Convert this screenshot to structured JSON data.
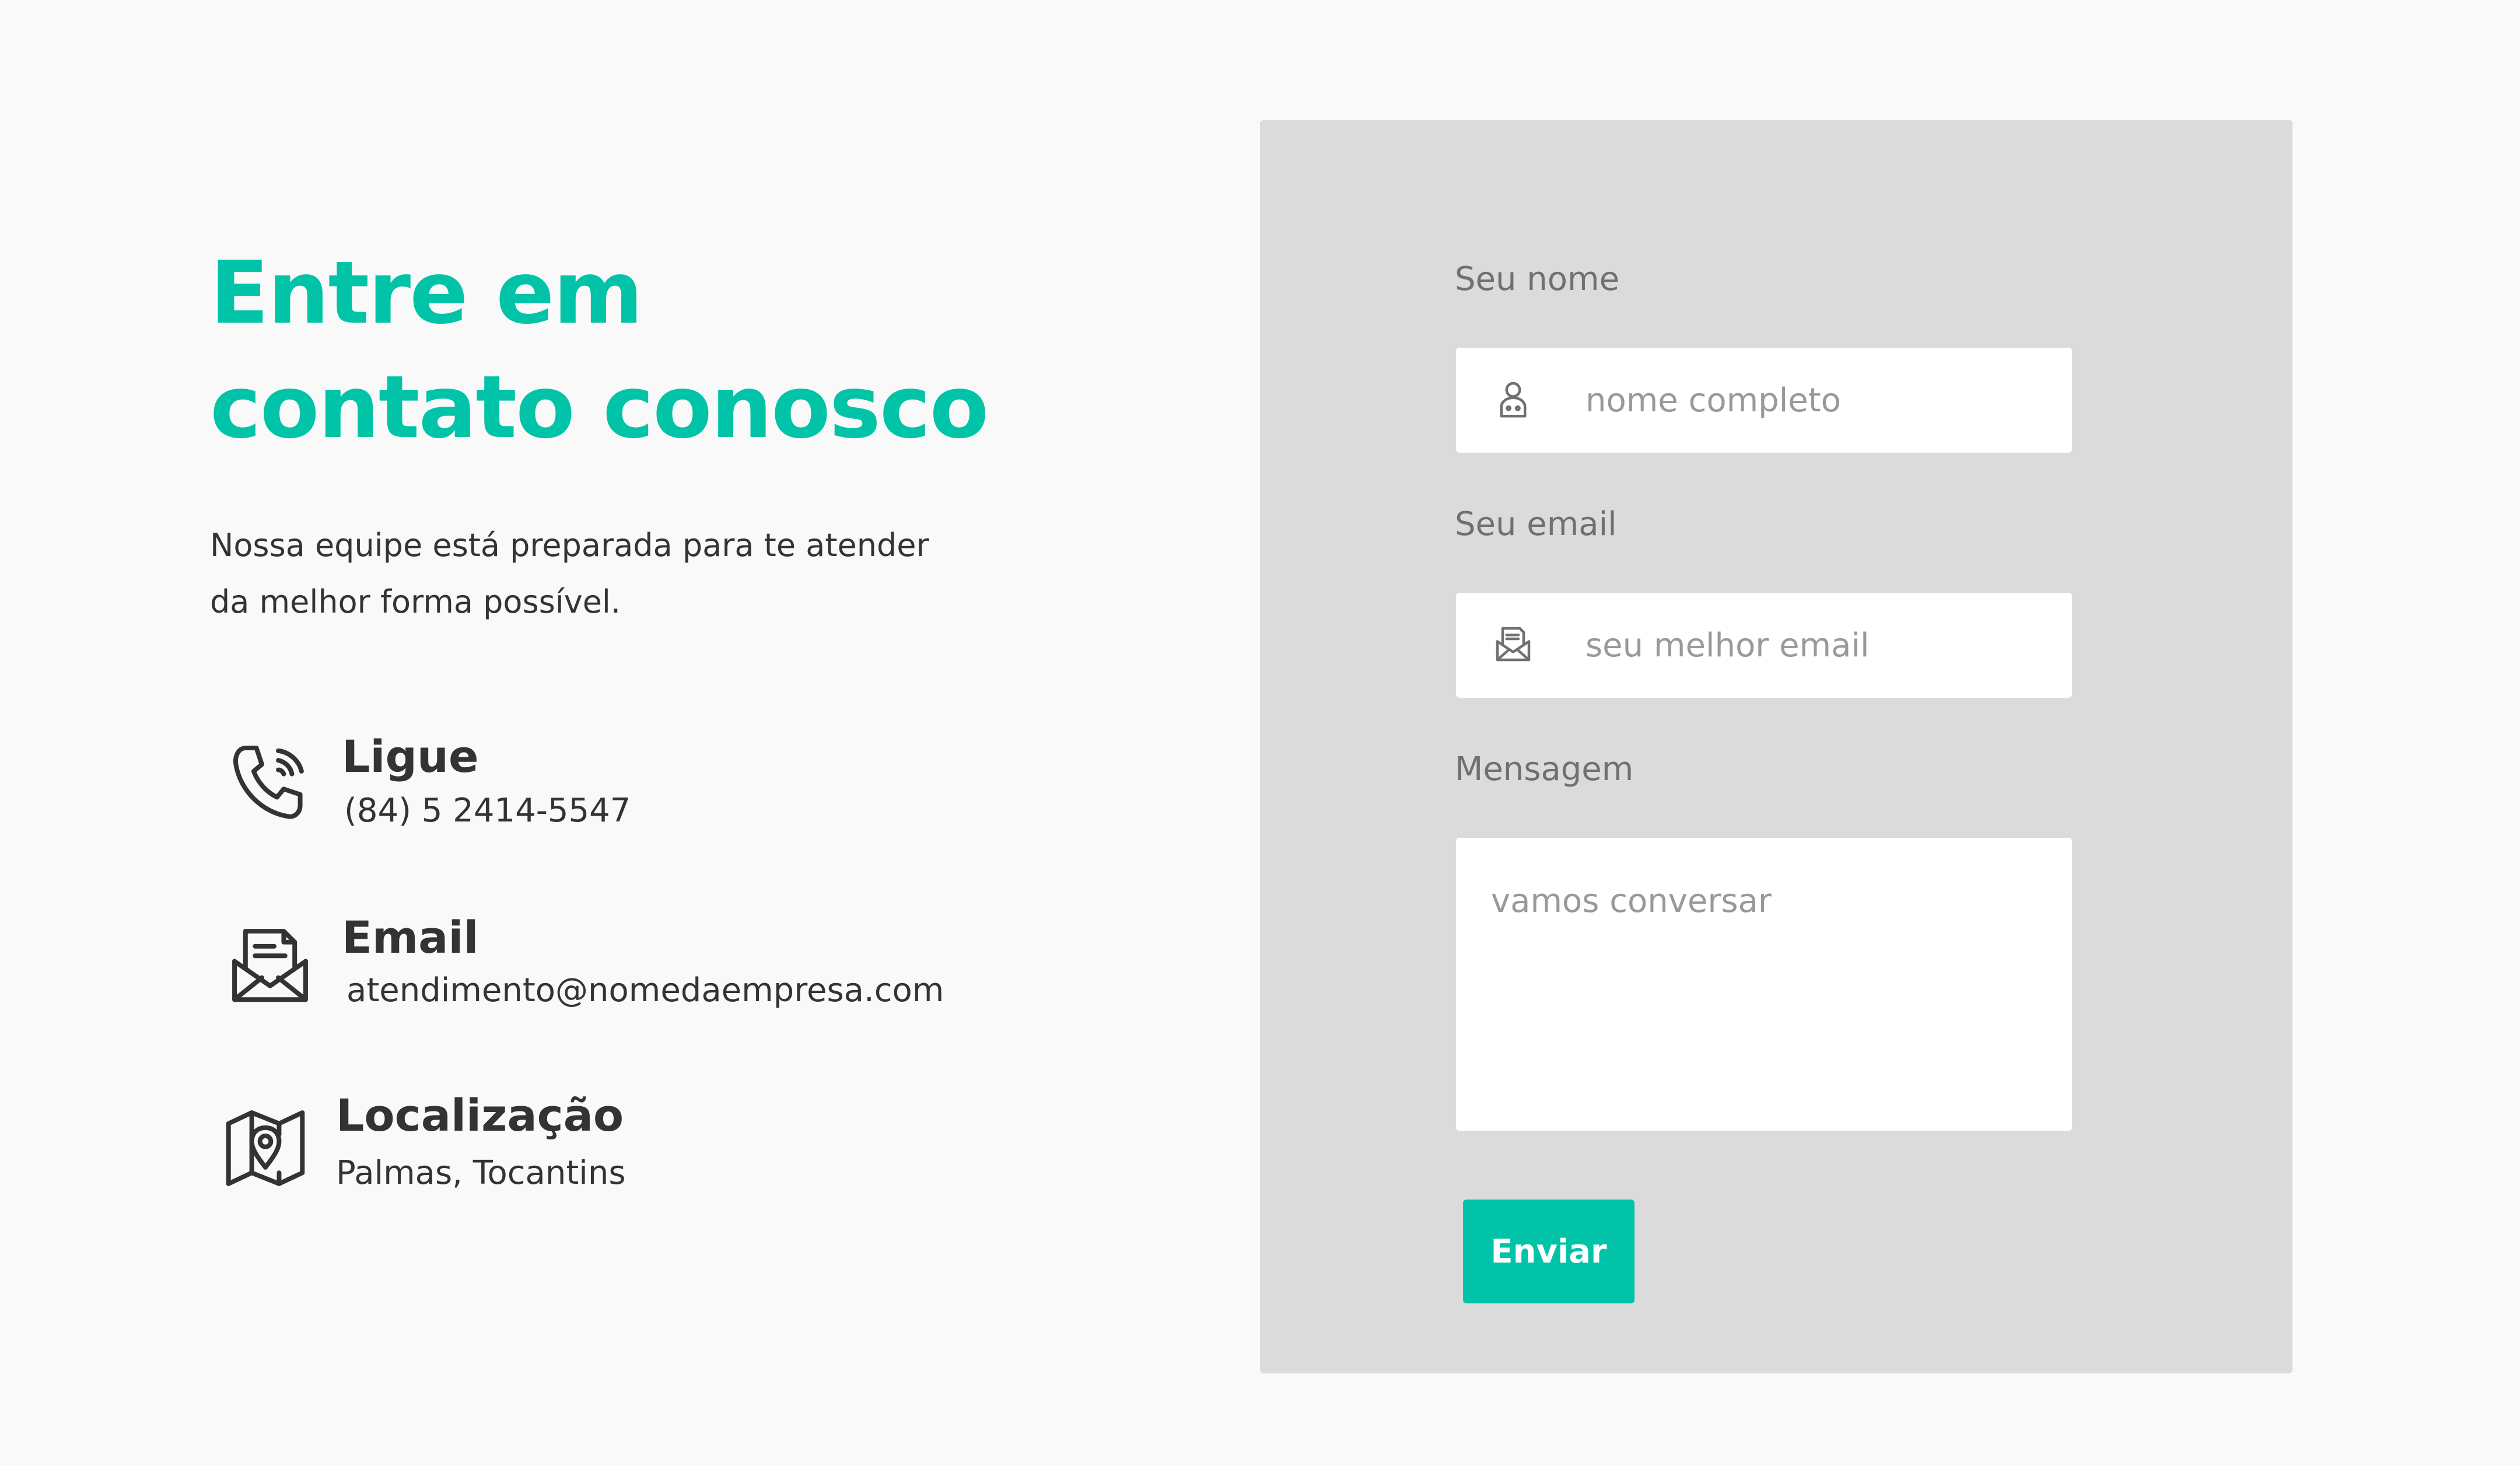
{
  "colors": {
    "accent": "#00c3a7",
    "background": "#f9f9f9",
    "panel": "#dbdbdb",
    "text": "#333333",
    "muted": "#707070",
    "placeholder": "#999999"
  },
  "intro": {
    "heading": "Entre em contato conosco",
    "subtitle": "Nossa equipe está preparada para te atender da melhor forma possível."
  },
  "contacts": [
    {
      "icon": "phone-icon",
      "title": "Ligue",
      "value": "(84) 5 2414-5547"
    },
    {
      "icon": "envelope-open-icon",
      "title": "Email",
      "value": "atendimento@nomedaempresa.com"
    },
    {
      "icon": "map-pin-icon",
      "title": "Localização",
      "value": "Palmas, Tocantins"
    }
  ],
  "form": {
    "name_label": "Seu nome",
    "name_placeholder": "nome completo",
    "name_icon": "user-icon",
    "email_label": "Seu email",
    "email_placeholder": "seu melhor email",
    "email_icon": "email-icon",
    "message_label": "Mensagem",
    "message_placeholder": "vamos conversar",
    "submit_label": "Enviar"
  }
}
